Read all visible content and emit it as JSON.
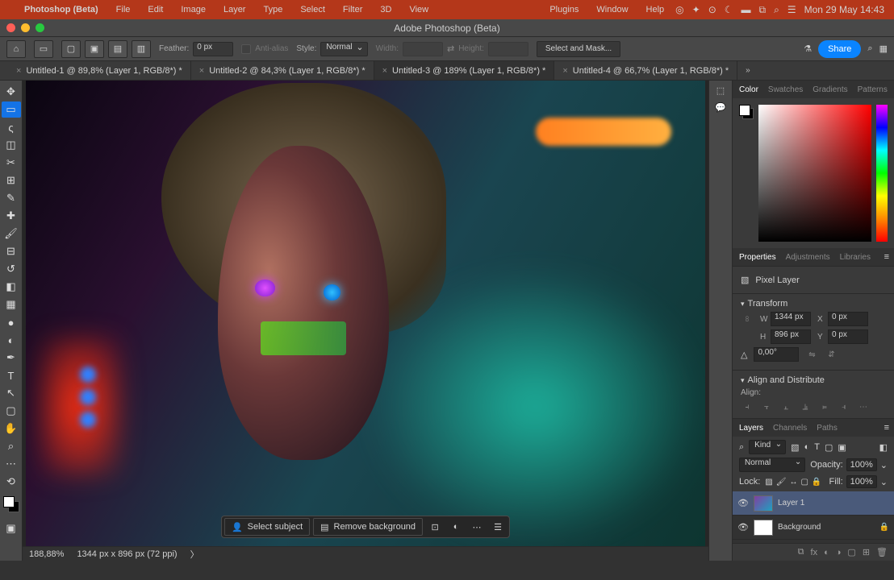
{
  "menubar": {
    "app": "Photoshop (Beta)",
    "items": [
      "File",
      "Edit",
      "Image",
      "Layer",
      "Type",
      "Select",
      "Filter",
      "3D",
      "View"
    ],
    "right_items": [
      "Plugins",
      "Window",
      "Help"
    ],
    "clock": "Mon 29 May  14:43"
  },
  "titlebar": {
    "title": "Adobe Photoshop (Beta)"
  },
  "options": {
    "feather_label": "Feather:",
    "feather_value": "0 px",
    "antialias_label": "Anti-alias",
    "style_label": "Style:",
    "style_value": "Normal",
    "width_label": "Width:",
    "height_label": "Height:",
    "select_mask_label": "Select and Mask...",
    "share_label": "Share"
  },
  "doc_tabs": [
    {
      "label": "Untitled-1 @ 89,8% (Layer 1, RGB/8*) *",
      "active": false
    },
    {
      "label": "Untitled-2 @ 84,3% (Layer 1, RGB/8*) *",
      "active": false
    },
    {
      "label": "Untitled-3 @ 189% (Layer 1, RGB/8*) *",
      "active": true
    },
    {
      "label": "Untitled-4 @ 66,7% (Layer 1, RGB/8*) *",
      "active": false
    }
  ],
  "statusbar": {
    "zoom": "188,88%",
    "doc_info": "1344 px x 896 px (72 ppi)"
  },
  "context": {
    "select_subject": "Select subject",
    "remove_bg": "Remove background"
  },
  "color_tabs": [
    "Color",
    "Swatches",
    "Gradients",
    "Patterns"
  ],
  "prop_tabs": [
    "Properties",
    "Adjustments",
    "Libraries"
  ],
  "properties": {
    "layer_type": "Pixel Layer",
    "transform_label": "Transform",
    "W": "1344 px",
    "H": "896 px",
    "X": "0 px",
    "Y": "0 px",
    "angle": "0,00°",
    "align_label": "Align and Distribute",
    "align_sub": "Align:"
  },
  "layers_tabs": [
    "Layers",
    "Channels",
    "Paths"
  ],
  "layers": {
    "kind_label": "Kind",
    "blend_mode": "Normal",
    "opacity_label": "Opacity:",
    "opacity_value": "100%",
    "lock_label": "Lock:",
    "fill_label": "Fill:",
    "fill_value": "100%",
    "items": [
      {
        "name": "Layer 1",
        "thumb": "img",
        "locked": false,
        "selected": true
      },
      {
        "name": "Background",
        "thumb": "white",
        "locked": true,
        "selected": false
      }
    ]
  }
}
